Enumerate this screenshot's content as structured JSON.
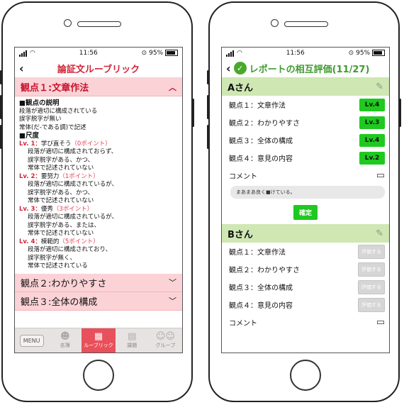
{
  "status": {
    "time": "11:56",
    "battery": "95%"
  },
  "left": {
    "title": "論証文ルーブリック",
    "back": "‹",
    "open_section": "観点１:文章作法",
    "desc_heading": "■観点の説明",
    "desc_lines": [
      "段落が適切に構成されている",
      "誤字脱字が無い",
      "常体(だ-である調)で記述"
    ],
    "scale_heading": "■尺度",
    "levels": [
      {
        "label": "Lv. 1：",
        "name": "学び直そう",
        "points": "（0ポイント）",
        "lines": [
          "段落が適切に構成されておらず、",
          "誤字脱字がある、かつ、",
          "常体で記述されていない"
        ]
      },
      {
        "label": "Lv. 2：",
        "name": "要努力",
        "points": "（1ポイント）",
        "lines": [
          "段落が適切に構成されているが、",
          "誤字脱字がある、かつ、",
          "常体で記述されていない"
        ]
      },
      {
        "label": "Lv. 3：",
        "name": "優秀",
        "points": "（3ポイント）",
        "lines": [
          "段落が適切に構成されているが、",
          "誤字脱字がある、または、",
          "常体で記述されていない"
        ]
      },
      {
        "label": "Lv. 4：",
        "name": "模範的",
        "points": "（5ポイント）",
        "lines": [
          "段落が適切に構成されており、",
          "誤字脱字が無く、",
          "常体で記述されている"
        ]
      }
    ],
    "collapsed": [
      "観点２:わかりやすさ",
      "観点３:全体の構成"
    ],
    "nav": {
      "menu": "MENU",
      "items": [
        "名簿",
        "ルーブリック",
        "課題",
        "グループ"
      ]
    }
  },
  "right": {
    "title": "レポートの相互評価(11/27)",
    "back": "‹",
    "groupA": {
      "name": "Aさん",
      "criteria": [
        {
          "label": "観点１：文章作法",
          "level": "Lv.4"
        },
        {
          "label": "観点２：わかりやすさ",
          "level": "Lv.3"
        },
        {
          "label": "観点３：全体の構成",
          "level": "Lv.4"
        },
        {
          "label": "観点４：意見の内容",
          "level": "Lv.2"
        }
      ],
      "comment_label": "コメント",
      "comment_text": "まあまあ良く■けている。",
      "confirm": "確定"
    },
    "groupB": {
      "name": "Bさん",
      "criteria": [
        {
          "label": "観点１：文章作法",
          "button": "評価する"
        },
        {
          "label": "観点２：わかりやすさ",
          "button": "評価する"
        },
        {
          "label": "観点３：全体の構成",
          "button": "評価する"
        },
        {
          "label": "観点４：意見の内容",
          "button": "評価する"
        }
      ],
      "comment_label": "コメント"
    }
  },
  "colors": {
    "red": "#d1253a",
    "pink": "#fbd3d6",
    "green": "#1fc91f",
    "green_header": "#cfe7b3"
  },
  "icons": [
    "wifi-icon",
    "signal-icon",
    "battery-icon",
    "chevron-up-icon",
    "chevron-down-icon",
    "check-circle-icon",
    "edit-note-icon",
    "speech-bubble-icon"
  ]
}
